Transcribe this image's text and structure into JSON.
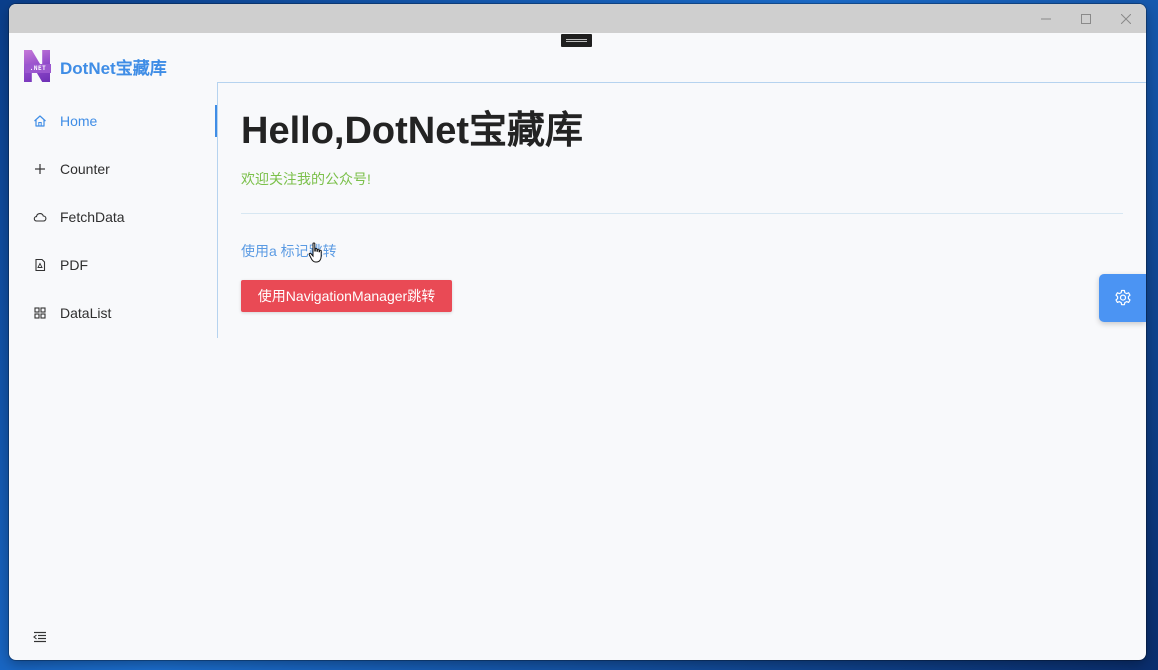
{
  "app": {
    "brand_title": "DotNet宝藏库",
    "logo_text": ".NET"
  },
  "titlebar": {
    "buttons": [
      "minimize",
      "maximize",
      "close"
    ]
  },
  "sidebar": {
    "items": [
      {
        "label": "Home",
        "icon": "home-icon",
        "active": true
      },
      {
        "label": "Counter",
        "icon": "plus-icon",
        "active": false
      },
      {
        "label": "FetchData",
        "icon": "cloud-icon",
        "active": false
      },
      {
        "label": "PDF",
        "icon": "pdf-file-icon",
        "active": false
      },
      {
        "label": "DataList",
        "icon": "grid-icon",
        "active": false
      }
    ],
    "collapse_icon": "menu-fold-icon"
  },
  "main": {
    "title": "Hello,DotNet宝藏库",
    "welcome_text": "欢迎关注我的公众号!",
    "a_link_text": "使用a 标记跳转",
    "nav_button_label": "使用NavigationManager跳转"
  },
  "settings": {
    "icon": "gear-icon"
  },
  "colors": {
    "accent": "#3f8de6",
    "welcome_green": "#7bc04a",
    "button_red": "#e94a55",
    "fab_blue": "#4b94f3"
  }
}
